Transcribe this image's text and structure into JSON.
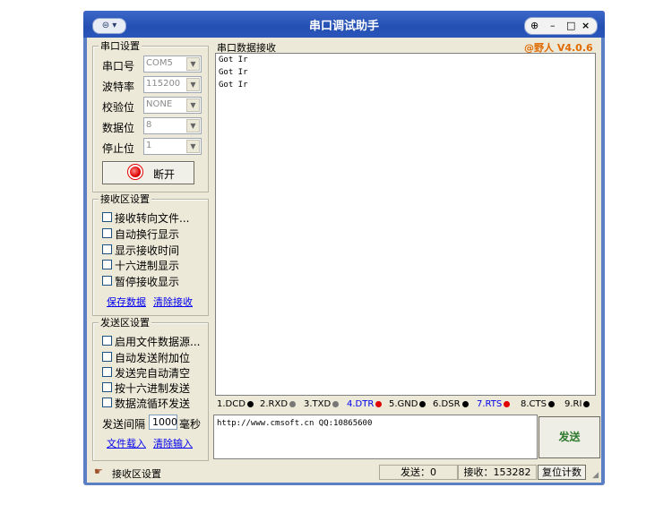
{
  "window": {
    "title": "串口调试助手",
    "sysmenu_icon": "menu-icon",
    "sysmenu_arrow": "▾",
    "pin": "⊕",
    "minimize": "–",
    "maximize": "□",
    "close": "×"
  },
  "port_settings": {
    "group_label": "串口设置",
    "fields": [
      {
        "label": "串口号",
        "value": "COM5"
      },
      {
        "label": "波特率",
        "value": "115200"
      },
      {
        "label": "校验位",
        "value": "NONE"
      },
      {
        "label": "数据位",
        "value": "8"
      },
      {
        "label": "停止位",
        "value": "1"
      }
    ],
    "open_button": "断开"
  },
  "receive_settings": {
    "group_label": "接收区设置",
    "options": [
      "接收转向文件...",
      "自动换行显示",
      "显示接收时间",
      "十六进制显示",
      "暂停接收显示"
    ],
    "save_link": "保存数据",
    "clear_link": "清除接收"
  },
  "send_settings": {
    "group_label": "发送区设置",
    "options": [
      "启用文件数据源...",
      "自动发送附加位",
      "发送完自动清空",
      "按十六进制发送",
      "数据流循环发送"
    ],
    "interval_label": "发送间隔",
    "interval_value": "1000",
    "interval_unit": "毫秒",
    "file_load_link": "文件载入",
    "clear_input_link": "清除输入"
  },
  "receive_area": {
    "label": "串口数据接收",
    "brand": "@野人 V4.0.6",
    "lines": [
      "Got Ir",
      "Got Ir",
      "Got Ir"
    ]
  },
  "signals": [
    {
      "label": "1.DCD",
      "color": "#000000",
      "highlight": false
    },
    {
      "label": "2.RXD",
      "color": "#777777",
      "highlight": false
    },
    {
      "label": "3.TXD",
      "color": "#777777",
      "highlight": false
    },
    {
      "label": "4.DTR",
      "color": "#e00000",
      "highlight": true
    },
    {
      "label": "5.GND",
      "color": "#000000",
      "highlight": false
    },
    {
      "label": "6.DSR",
      "color": "#000000",
      "highlight": false
    },
    {
      "label": "7.RTS",
      "color": "#e00000",
      "highlight": true
    },
    {
      "label": "8.CTS",
      "color": "#000000",
      "highlight": false
    },
    {
      "label": "9.RI",
      "color": "#000000",
      "highlight": false
    }
  ],
  "send_area": {
    "text": "http://www.cmsoft.cn QQ:10865600",
    "send_button": "发送"
  },
  "status_bar": {
    "icon": "hand-pointer-icon",
    "text": "接收区设置",
    "sent": "发送：0",
    "received": "接收：153282",
    "reset_button": "复位计数"
  }
}
